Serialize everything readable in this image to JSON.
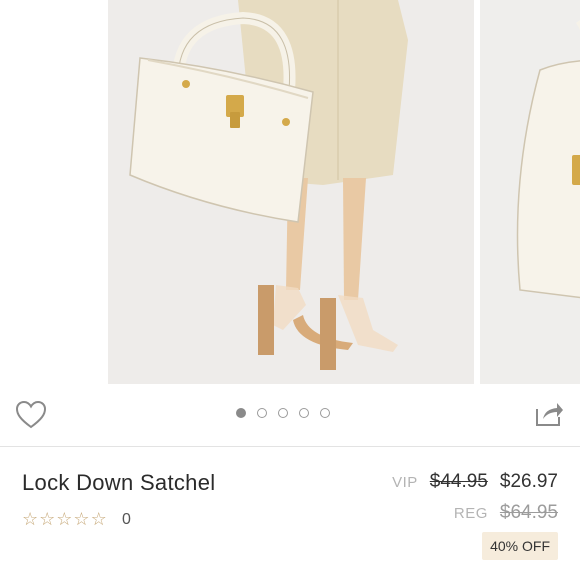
{
  "product": {
    "name": "Lock Down Satchel",
    "rating_count": "0",
    "rating_stars": 0,
    "stars_max": 5
  },
  "pricing": {
    "vip_label": "VIP",
    "vip_original": "$44.95",
    "vip_sale": "$26.97",
    "reg_label": "REG",
    "reg_price": "$64.95",
    "discount_badge": "40% OFF"
  },
  "carousel": {
    "slide_count": 5,
    "active_index": 0
  },
  "icons": {
    "favorite": "heart-icon",
    "share": "share-icon",
    "star": "star-outline-icon"
  },
  "colors": {
    "accent_gold": "#c7a979",
    "badge_bg": "#f6ecdc",
    "bag_cream": "#f3eee3"
  }
}
